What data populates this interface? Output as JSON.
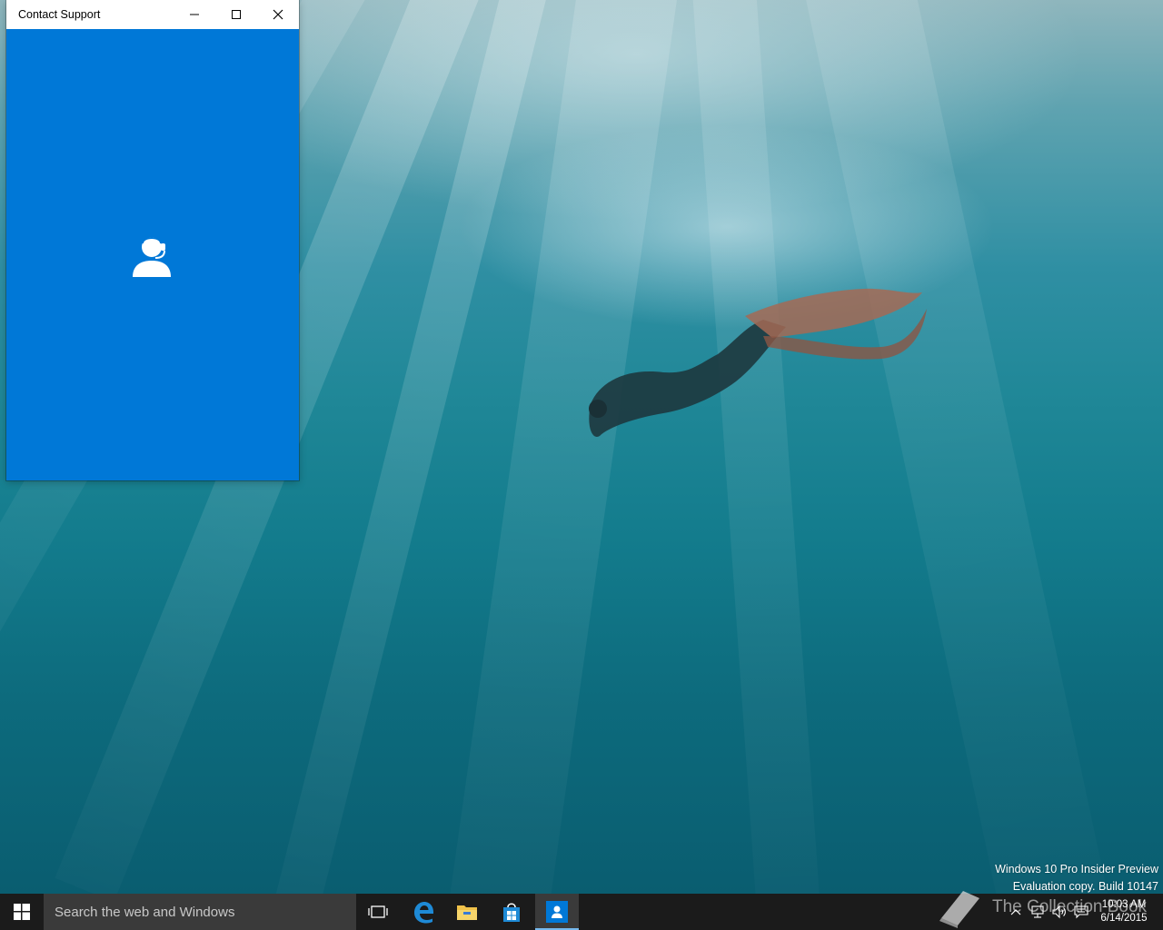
{
  "window": {
    "title": "Contact Support",
    "minimize_icon": "minimize-icon",
    "maximize_icon": "maximize-icon",
    "close_icon": "close-icon",
    "body_icon": "support-agent-icon",
    "accent_color": "#0078d7"
  },
  "desktop": {
    "watermark_line1": "Windows 10 Pro Insider Preview",
    "watermark_line2": "Evaluation copy. Build 10147"
  },
  "taskbar": {
    "search_placeholder": "Search the web and Windows",
    "pinned": [
      {
        "name": "task-view",
        "icon": "task-view-icon"
      },
      {
        "name": "edge",
        "icon": "edge-icon"
      },
      {
        "name": "file-explorer",
        "icon": "folder-icon"
      },
      {
        "name": "store",
        "icon": "store-icon"
      },
      {
        "name": "contact-support",
        "icon": "support-agent-icon",
        "active": true
      }
    ],
    "tray": {
      "time": "10:03 AM",
      "date": "6/14/2015"
    },
    "brand_watermark": "The Collection Book"
  }
}
